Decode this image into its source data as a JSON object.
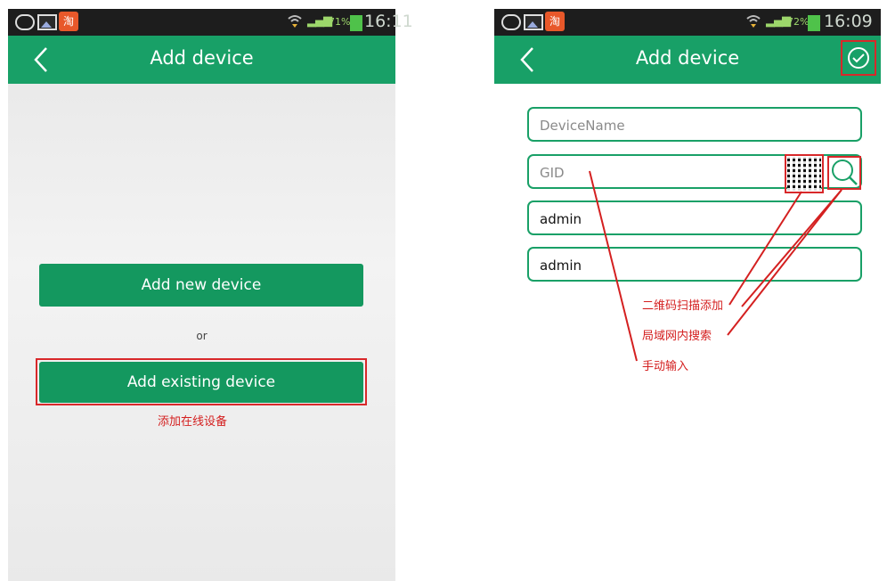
{
  "left_screen": {
    "statusbar": {
      "tao_label": "淘",
      "battery_pct": "71%",
      "time": "16:11"
    },
    "appbar": {
      "title": "Add device"
    },
    "add_new_label": "Add new device",
    "or_label": "or",
    "add_existing_label": "Add existing device",
    "annotation": "添加在线设备"
  },
  "right_screen": {
    "statusbar": {
      "tao_label": "淘",
      "battery_pct": "72%",
      "time": "16:09"
    },
    "appbar": {
      "title": "Add device"
    },
    "fields": {
      "device_name_placeholder": "DeviceName",
      "gid_placeholder": "GID",
      "username_value": "admin",
      "password_value": "admin"
    },
    "annotations": {
      "qr_scan": "二维码扫描添加",
      "lan_search": "局域网内搜索",
      "manual_input": "手动输入"
    }
  },
  "colors": {
    "accent": "#18a067",
    "highlight": "#d8282a",
    "statusbar": "#1d1d1d"
  },
  "icons": [
    "cloud-icon",
    "image-icon",
    "taobao-icon",
    "wifi-icon",
    "signal-icon",
    "battery-icon",
    "back-arrow-icon",
    "check-circle-icon",
    "qr-code-icon",
    "search-icon"
  ]
}
